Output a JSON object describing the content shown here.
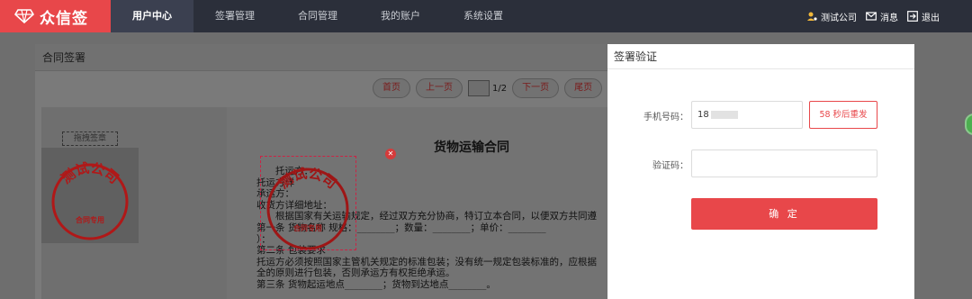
{
  "app": {
    "logo_text": "众信签",
    "brand_color": "#e8474a"
  },
  "nav": {
    "items": [
      {
        "label": "用户中心",
        "active": true
      },
      {
        "label": "签署管理"
      },
      {
        "label": "合同管理"
      },
      {
        "label": "我的账户"
      },
      {
        "label": "系统设置"
      }
    ],
    "company": "测试公司",
    "messages": "消息",
    "logout": "退出"
  },
  "contract_panel": {
    "title": "合同签署",
    "pager": {
      "first": "首页",
      "prev": "上一页",
      "page_indicator": "1/2",
      "next": "下一页",
      "last": "尾页"
    },
    "drag_label": "拖拽签章",
    "stamp": {
      "company": "测试公司",
      "purpose": "合同专用"
    },
    "document": {
      "title": "货物运输合同",
      "lines": [
        "托运方：",
        "托运方详",
        "承运方：",
        "收货方详细地址：",
        "根据国家有关运输规定，经过双方充分协商，特订立本合同，以便双方共同遵",
        "第一条  货物名称         规格：________；数量：________；单价：________",
        "）：",
        "第二条  包装要求",
        "托运方必须按照国家主管机关规定的标准包装；没有统一规定包装标准的，应根据",
        "全的原则进行包装，否则承运方有权拒绝承运。",
        "第三条  货物起运地点________；货物到达地点________。"
      ]
    }
  },
  "verify_modal": {
    "title": "签署验证",
    "phone_label": "手机号码：",
    "phone_value": "18",
    "resend_label": "58 秒后重发",
    "code_label": "验证码：",
    "code_value": "",
    "confirm_label": "确 定"
  }
}
